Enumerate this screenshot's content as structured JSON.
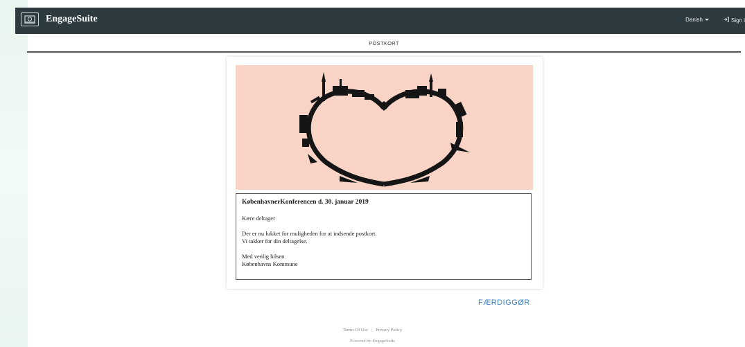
{
  "header": {
    "brand": "EngageSuite",
    "language": "Danish",
    "sign_in": "Sign i"
  },
  "tabs": {
    "active": "POSTKORT"
  },
  "postcard": {
    "image_icon": "heart-skyline-image",
    "title": "KøbenhavnerKonferencen d. 30. januar 2019",
    "greeting": "Kære deltager",
    "line1": "Der er nu lukket for muligheden for at indsende postkort.",
    "line2": "Vi takker for din deltagelse.",
    "closing": "Med venlig hilsen",
    "signature": "Københavns Kommune"
  },
  "actions": {
    "finish": "FÆRDIGGØR"
  },
  "footer": {
    "terms": "Terms Of Use",
    "privacy": "Privacy Policy",
    "powered": "Powered by EngageSuite"
  },
  "colors": {
    "header_bg": "#2d3a40",
    "postcard_bg": "#f9d4c6",
    "accent": "#3a7fc1"
  }
}
